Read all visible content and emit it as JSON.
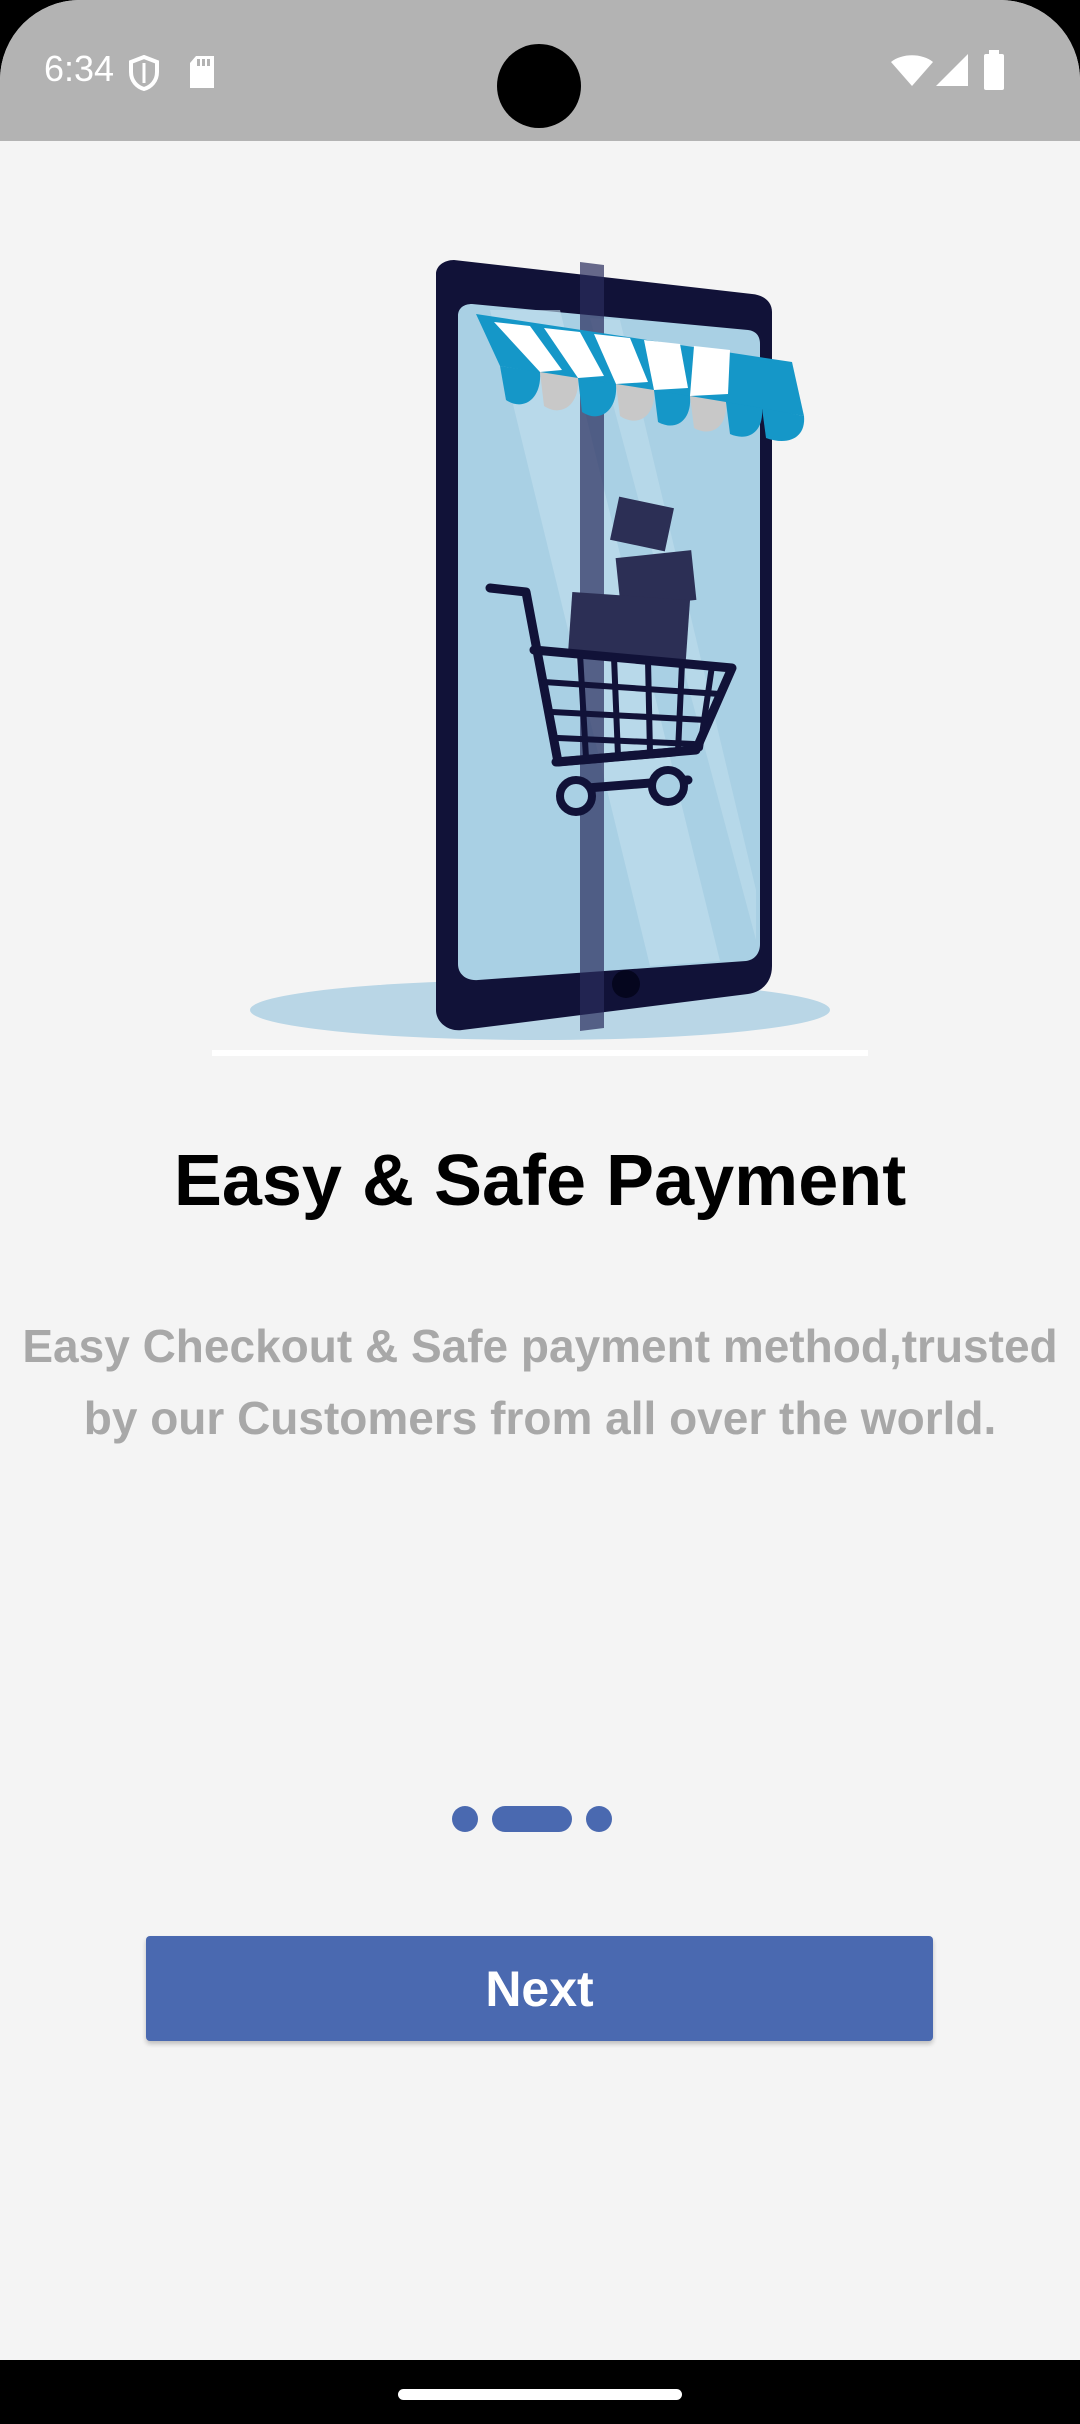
{
  "status_bar": {
    "time": "6:34",
    "icons": [
      "shield-icon",
      "sd-card-icon",
      "wifi-icon",
      "signal-icon",
      "battery-icon"
    ]
  },
  "illustration": {
    "icons": [
      "smartphone-icon",
      "store-awning-icon",
      "shopping-cart-icon",
      "package-box-icon"
    ],
    "colors": {
      "phone_body": "#111238",
      "screen": "#a9d0e4",
      "awning_blue": "#1597c8",
      "awning_grey": "#c8c8c8",
      "shadow": "#b9d6e6"
    }
  },
  "onboarding": {
    "title": "Easy & Safe Payment",
    "description": "Easy Checkout & Safe payment method,trusted by our Customers from all over the world.",
    "page_indicator": {
      "total": 3,
      "current": 2
    },
    "next_label": "Next"
  },
  "colors": {
    "accent": "#4a69b0",
    "background": "#f4f4f4",
    "status_bar": "#b3b3b3",
    "description_text": "#a8a8a8"
  }
}
